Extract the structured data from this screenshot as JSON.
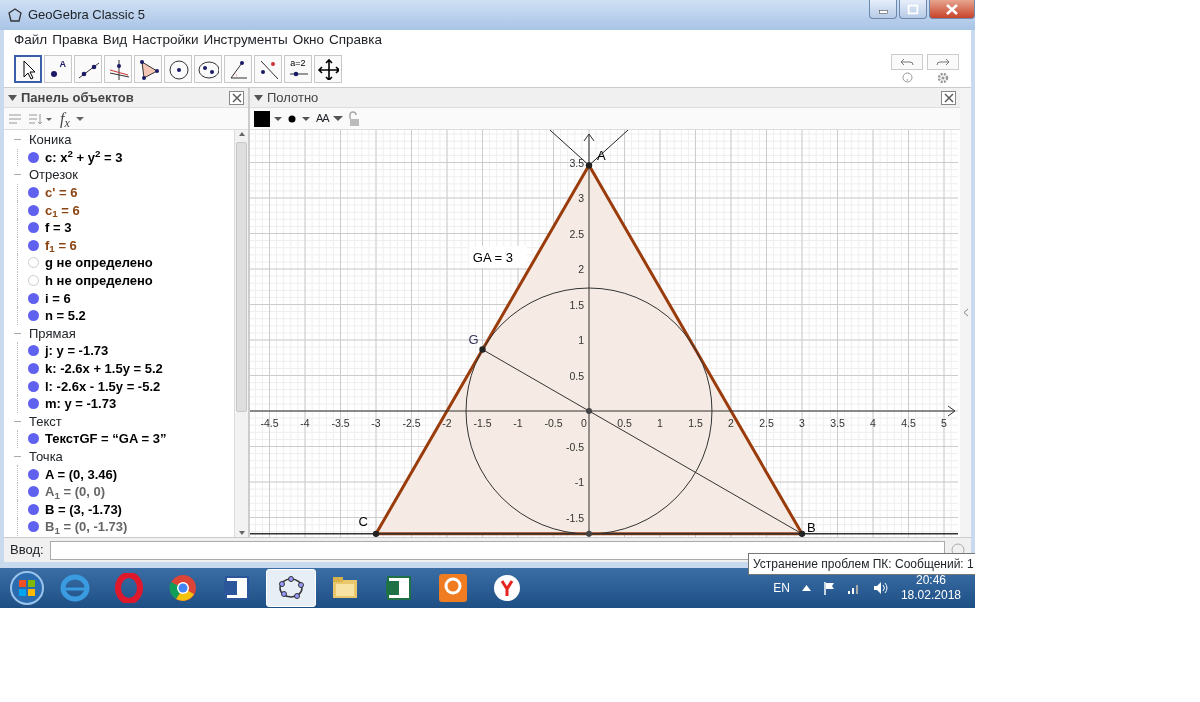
{
  "window": {
    "title": "GeoGebra Classic 5"
  },
  "menu": [
    "Файл",
    "Правка",
    "Вид",
    "Настройки",
    "Инструменты",
    "Окно",
    "Справка"
  ],
  "tools": [
    {
      "kind": "move",
      "selected": true
    },
    {
      "kind": "point",
      "label": "A",
      "selected": false
    },
    {
      "kind": "line",
      "selected": false
    },
    {
      "kind": "perpendicular",
      "selected": false
    },
    {
      "kind": "polygon",
      "selected": false
    },
    {
      "kind": "circle",
      "selected": false
    },
    {
      "kind": "conic",
      "selected": false
    },
    {
      "kind": "angle",
      "selected": false
    },
    {
      "kind": "reflect",
      "selected": false
    },
    {
      "kind": "slider",
      "label": "a=2",
      "selected": false
    },
    {
      "kind": "move_view",
      "selected": false
    }
  ],
  "algebra": {
    "title": "Панель объектов",
    "fx": "f$_{x}$",
    "groups": [
      {
        "name": "Коника",
        "expanded": true,
        "items": [
          {
            "text": "c: x$^{2}$ + y$^{2}$ = 3",
            "visible": true,
            "color": "#000000"
          }
        ]
      },
      {
        "name": "Отрезок",
        "expanded": true,
        "items": [
          {
            "text": "c' = 6",
            "visible": true,
            "color": "#8b4513"
          },
          {
            "text": "c$_{1}$ = 6",
            "visible": true,
            "color": "#8b4513"
          },
          {
            "text": "f = 3",
            "visible": true,
            "color": "#000000"
          },
          {
            "text": "f$_{1}$ = 6",
            "visible": true,
            "color": "#8b4513"
          },
          {
            "text": "g не определено",
            "visible": false,
            "color": "#000000"
          },
          {
            "text": "h не определено",
            "visible": false,
            "color": "#000000"
          },
          {
            "text": "i = 6",
            "visible": true,
            "color": "#000000"
          },
          {
            "text": "n = 5.2",
            "visible": true,
            "color": "#000000"
          }
        ]
      },
      {
        "name": "Прямая",
        "expanded": true,
        "items": [
          {
            "text": "j: y = -1.73",
            "visible": true,
            "color": "#000000"
          },
          {
            "text": "k: -2.6x + 1.5y = 5.2",
            "visible": true,
            "color": "#000000"
          },
          {
            "text": "l: -2.6x - 1.5y = -5.2",
            "visible": true,
            "color": "#000000"
          },
          {
            "text": "m: y = -1.73",
            "visible": true,
            "color": "#000000"
          }
        ]
      },
      {
        "name": "Текст",
        "expanded": true,
        "items": [
          {
            "text": "ТекстGF = “GA = 3”",
            "visible": true,
            "color": "#000000"
          }
        ]
      },
      {
        "name": "Точка",
        "expanded": true,
        "items": [
          {
            "text": "A = (0, 3.46)",
            "visible": true,
            "color": "#000000"
          },
          {
            "text": "A$_{1}$ = (0, 0)",
            "visible": true,
            "color": "#666666"
          },
          {
            "text": "B = (3, -1.73)",
            "visible": true,
            "color": "#000000"
          },
          {
            "text": "B$_{1}$ = (0, -1.73)",
            "visible": true,
            "color": "#666666"
          }
        ]
      }
    ]
  },
  "graphics": {
    "title": "Полотно",
    "text_style": "AA",
    "xticks": [
      "-4.5",
      "-4",
      "-3.5",
      "-3",
      "-2.5",
      "-2",
      "-1.5",
      "-1",
      "-0.5",
      "0",
      "0.5",
      "1",
      "1.5",
      "2",
      "2.5",
      "3",
      "3.5",
      "4",
      "4.5",
      "5"
    ],
    "yticks": [
      "3.5",
      "3",
      "2.5",
      "2",
      "1.5",
      "1",
      "0.5",
      "-0.5",
      "-1",
      "-1.5"
    ],
    "points": [
      {
        "label": "A"
      },
      {
        "label": "B"
      },
      {
        "label": "C"
      },
      {
        "label": "G"
      }
    ],
    "caption": "GA = 3"
  },
  "input_bar": {
    "label": "Ввод:"
  },
  "tooltip": "Устранение проблем ПК: Сообщений: 1",
  "taskbar": {
    "apps": [
      {
        "kind": "browser-e",
        "selected": false
      },
      {
        "kind": "browser-o",
        "selected": false
      },
      {
        "kind": "browser-c",
        "selected": false
      },
      {
        "kind": "word",
        "selected": false
      },
      {
        "kind": "geogebra",
        "selected": true
      },
      {
        "kind": "folder",
        "selected": false
      },
      {
        "kind": "excel",
        "selected": false
      },
      {
        "kind": "pdf",
        "selected": false
      },
      {
        "kind": "browser-y",
        "selected": false
      }
    ],
    "language": "EN",
    "time": "20:46",
    "date": "18.02.2018"
  }
}
